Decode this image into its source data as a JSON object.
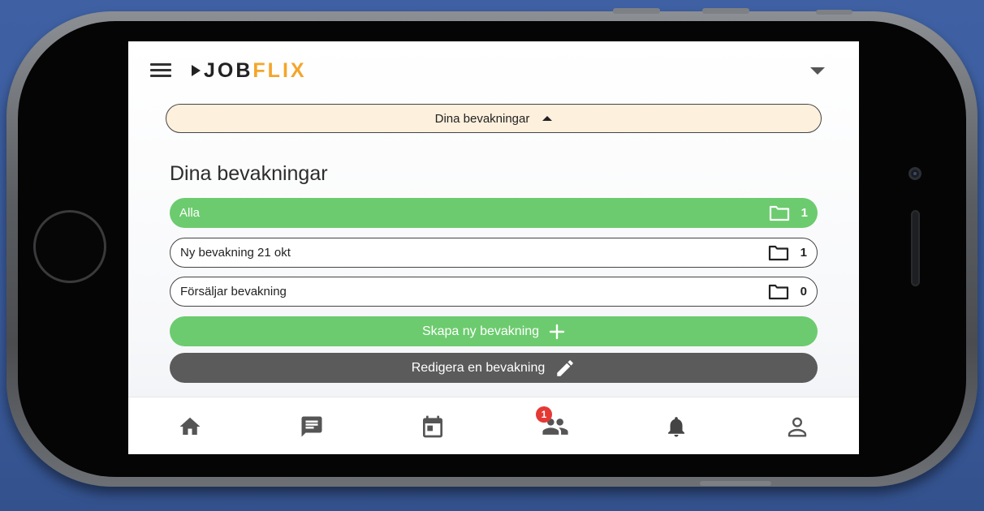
{
  "app": {
    "logo_prefix": "JOB",
    "logo_suffix": "FLIX"
  },
  "toggle": {
    "label": "Dina bevakningar"
  },
  "section": {
    "title": "Dina bevakningar"
  },
  "items": [
    {
      "label": "Alla",
      "count": "1",
      "icon": "folder-icon"
    },
    {
      "label": "Ny bevakning 21 okt",
      "count": "1",
      "icon": "folder-icon"
    },
    {
      "label": "Försäljar bevakning",
      "count": "0",
      "icon": "folder-icon"
    }
  ],
  "actions": {
    "create_label": "Skapa ny bevakning",
    "edit_label": "Redigera en bevakning"
  },
  "bottom_nav": {
    "items": [
      "home-icon",
      "chat-icon",
      "calendar-icon",
      "people-icon",
      "bell-icon",
      "profile-icon"
    ],
    "badge_count": "1"
  },
  "colors": {
    "green": "#6ccb6e",
    "dark_button": "#5b5b5b",
    "logo_accent": "#f4a52a",
    "pill_bg": "#fdf0dd",
    "badge": "#e53935"
  }
}
